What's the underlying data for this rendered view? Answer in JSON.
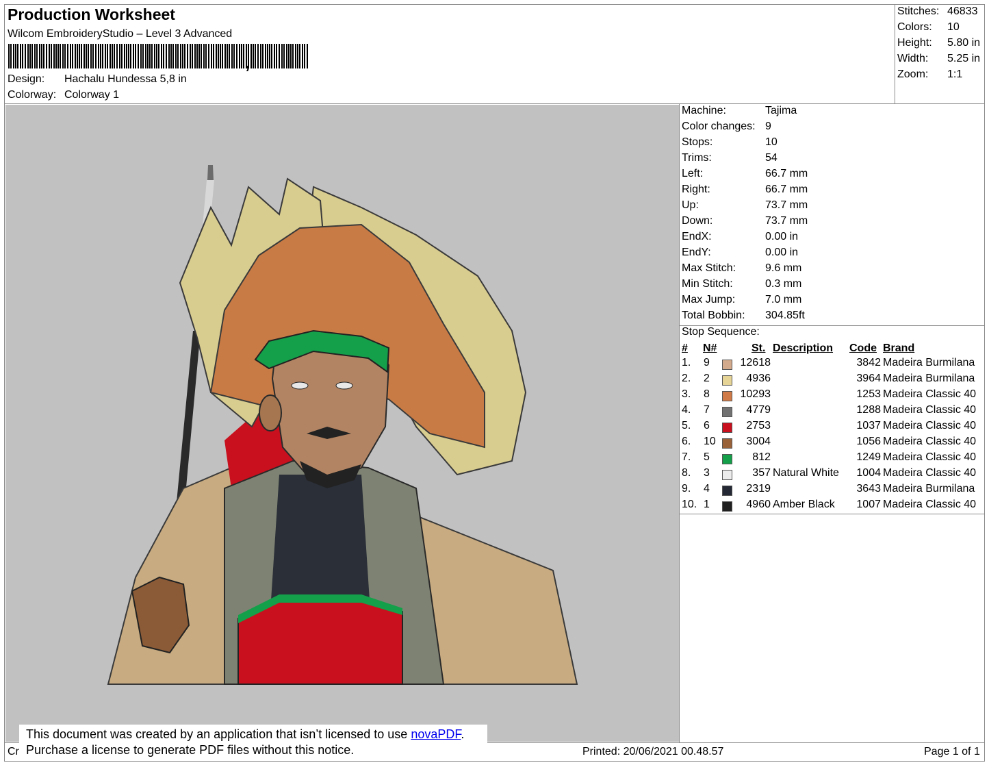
{
  "header": {
    "title": "Production Worksheet",
    "software": "Wilcom EmbroideryStudio – Level 3 Advanced",
    "comma": ",",
    "design_label": "Design:",
    "design_value": "Hachalu Hundessa 5,8 in",
    "colorway_label": "Colorway:",
    "colorway_value": "Colorway 1"
  },
  "stats": [
    {
      "label": "Stitches:",
      "value": "46833"
    },
    {
      "label": "Colors:",
      "value": "10"
    },
    {
      "label": "Height:",
      "value": "5.80 in"
    },
    {
      "label": "Width:",
      "value": "5.25 in"
    },
    {
      "label": "Zoom:",
      "value": "1:1"
    }
  ],
  "machine_info": [
    {
      "label": "Machine:",
      "value": "Tajima"
    },
    {
      "label": "Color changes:",
      "value": "9"
    },
    {
      "label": "Stops:",
      "value": "10"
    },
    {
      "label": "Trims:",
      "value": "54"
    },
    {
      "label": "Left:",
      "value": "66.7 mm"
    },
    {
      "label": "Right:",
      "value": "66.7 mm"
    },
    {
      "label": "Up:",
      "value": "73.7 mm"
    },
    {
      "label": "Down:",
      "value": "73.7 mm"
    },
    {
      "label": "EndX:",
      "value": "0.00 in"
    },
    {
      "label": "EndY:",
      "value": "0.00 in"
    },
    {
      "label": "Max Stitch:",
      "value": "9.6 mm"
    },
    {
      "label": "Min Stitch:",
      "value": "0.3 mm"
    },
    {
      "label": "Max Jump:",
      "value": "7.0 mm"
    },
    {
      "label": "Total Bobbin:",
      "value": "304.85ft"
    }
  ],
  "stop_sequence": {
    "title": "Stop Sequence:",
    "headers": {
      "num": "#",
      "needle": "N#",
      "stitches": "St.",
      "description": "Description",
      "code": "Code",
      "brand": "Brand"
    },
    "rows": [
      {
        "num": "1.",
        "needle": "9",
        "color": "#d4aa8c",
        "stitches": "12618",
        "description": "",
        "code": "3842",
        "brand": "Madeira Burmilana"
      },
      {
        "num": "2.",
        "needle": "2",
        "color": "#e6d496",
        "stitches": "4936",
        "description": "",
        "code": "3964",
        "brand": "Madeira Burmilana"
      },
      {
        "num": "3.",
        "needle": "8",
        "color": "#cf7a47",
        "stitches": "10293",
        "description": "",
        "code": "1253",
        "brand": "Madeira Classic 40"
      },
      {
        "num": "4.",
        "needle": "7",
        "color": "#727272",
        "stitches": "4779",
        "description": "",
        "code": "1288",
        "brand": "Madeira Classic 40"
      },
      {
        "num": "5.",
        "needle": "6",
        "color": "#c8101e",
        "stitches": "2753",
        "description": "",
        "code": "1037",
        "brand": "Madeira Classic 40"
      },
      {
        "num": "6.",
        "needle": "10",
        "color": "#9a6239",
        "stitches": "3004",
        "description": "",
        "code": "1056",
        "brand": "Madeira Classic 40"
      },
      {
        "num": "7.",
        "needle": "5",
        "color": "#14a04a",
        "stitches": "812",
        "description": "",
        "code": "1249",
        "brand": "Madeira Classic 40"
      },
      {
        "num": "8.",
        "needle": "3",
        "color": "#ececec",
        "stitches": "357",
        "description": "Natural White",
        "code": "1004",
        "brand": "Madeira Classic 40"
      },
      {
        "num": "9.",
        "needle": "4",
        "color": "#232834",
        "stitches": "2319",
        "description": "",
        "code": "3643",
        "brand": "Madeira Burmilana"
      },
      {
        "num": "10.",
        "needle": "1",
        "color": "#202020",
        "stitches": "4960",
        "description": "Amber Black",
        "code": "1007",
        "brand": "Madeira Classic 40"
      }
    ]
  },
  "notice": {
    "line1_prefix": "This document was created by an application that isn’t licensed to use ",
    "link": "novaPDF",
    "line1_suffix": ".",
    "line2": "Purchase a license to generate PDF files without this notice."
  },
  "footer": {
    "left_fragment": "Cr",
    "printed": "Printed: 20/06/2021 00.48.57",
    "page": "Page 1 of 1"
  },
  "artwork": {
    "subject": "embroidered portrait",
    "background_color": "#c1c1c1"
  }
}
